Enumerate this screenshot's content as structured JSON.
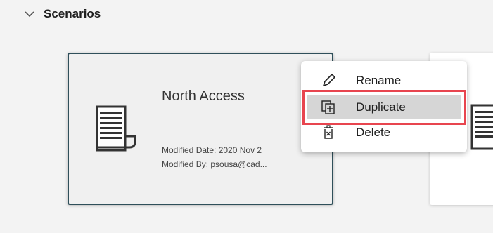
{
  "section": {
    "title": "Scenarios",
    "expanded": true
  },
  "scenario_card": {
    "name": "North Access",
    "modified_date": "Modified Date: 2020 Nov 2",
    "modified_by": "Modified By: psousa@cad..."
  },
  "context_menu": {
    "items": [
      {
        "label": "Rename",
        "icon": "pencil-icon"
      },
      {
        "label": "Duplicate",
        "icon": "duplicate-icon",
        "highlighted": true
      },
      {
        "label": "Delete",
        "icon": "delete-icon"
      }
    ]
  },
  "colors": {
    "card_border": "#2f4f5a",
    "highlight_outline": "#e8454f",
    "menu_hover": "#d6d6d6",
    "background": "#f3f3f3"
  }
}
